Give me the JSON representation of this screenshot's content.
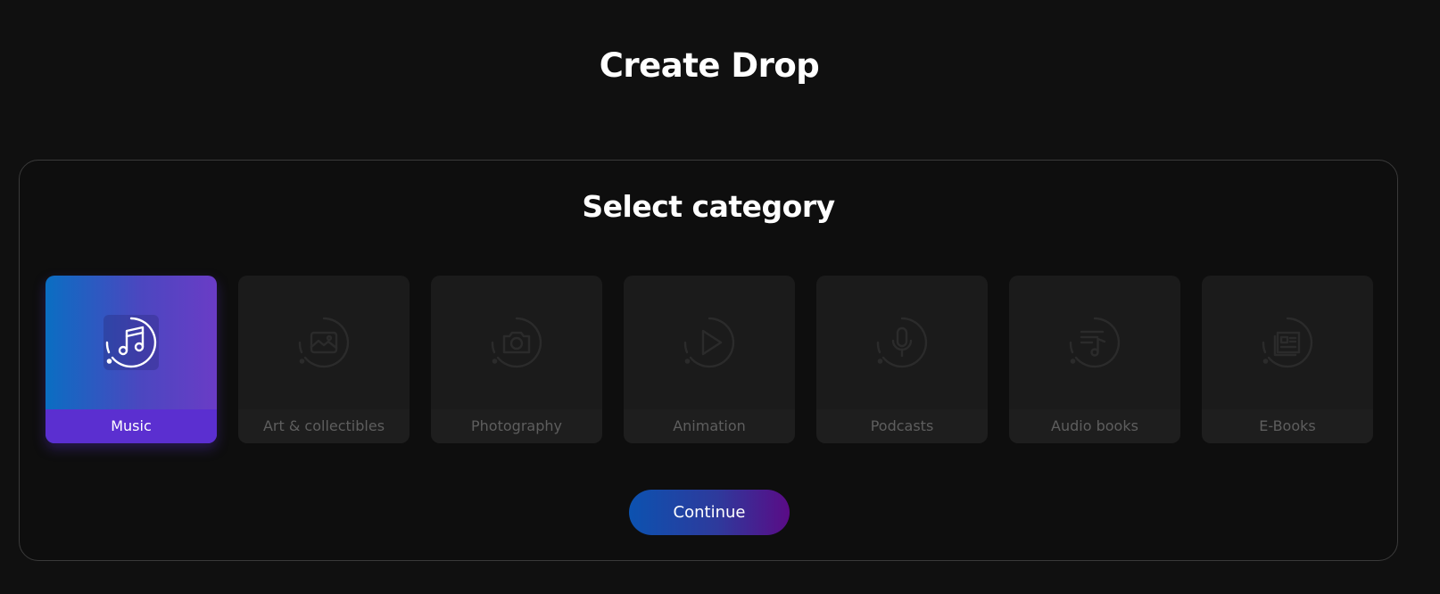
{
  "header": {
    "title": "Create Drop"
  },
  "panel": {
    "title": "Select category",
    "categories": [
      {
        "label": "Music",
        "icon": "music-note-icon",
        "selected": true
      },
      {
        "label": "Art & collectibles",
        "icon": "image-icon",
        "selected": false
      },
      {
        "label": "Photography",
        "icon": "camera-icon",
        "selected": false
      },
      {
        "label": "Animation",
        "icon": "play-icon",
        "selected": false
      },
      {
        "label": "Podcasts",
        "icon": "microphone-icon",
        "selected": false
      },
      {
        "label": "Audio books",
        "icon": "audio-list-icon",
        "selected": false
      },
      {
        "label": "E-Books",
        "icon": "book-icon",
        "selected": false
      }
    ],
    "continue_label": "Continue"
  },
  "colors": {
    "background": "#101010",
    "card": "#1b1b1b",
    "selected_label": "#5b2fd0",
    "button_start": "#0c52b0",
    "button_end": "#5a0b86"
  }
}
